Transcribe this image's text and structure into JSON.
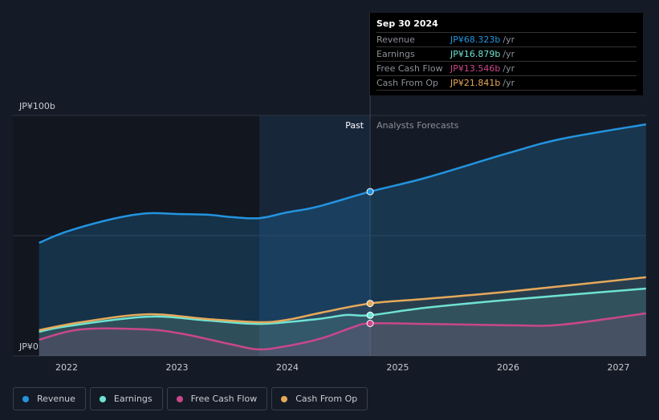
{
  "tooltip": {
    "date": "Sep 30 2024",
    "unit": "/yr",
    "rows": [
      {
        "label": "Revenue",
        "value": "JP¥68.323b",
        "color": "#2394df"
      },
      {
        "label": "Earnings",
        "value": "JP¥16.879b",
        "color": "#6fe3d3"
      },
      {
        "label": "Free Cash Flow",
        "value": "JP¥13.546b",
        "color": "#c9478a"
      },
      {
        "label": "Cash From Op",
        "value": "JP¥21.841b",
        "color": "#e6a95a"
      }
    ]
  },
  "chart_data": {
    "type": "line",
    "ylim": [
      0,
      100
    ],
    "y_ticks": [
      "JP¥0",
      "JP¥100b"
    ],
    "x_ticks": [
      "2022",
      "2023",
      "2024",
      "2025",
      "2026",
      "2027"
    ],
    "past_label": "Past",
    "forecast_label": "Analysts Forecasts",
    "divider_x": 2024.75,
    "series": [
      {
        "name": "Revenue",
        "color": "#2394df",
        "points": [
          [
            2021.75,
            47
          ],
          [
            2022,
            51.7
          ],
          [
            2022.42,
            57
          ],
          [
            2022.73,
            59.3
          ],
          [
            2023,
            59
          ],
          [
            2023.28,
            58.7
          ],
          [
            2023.5,
            57.7
          ],
          [
            2023.75,
            57.3
          ],
          [
            2024,
            59.7
          ],
          [
            2024.27,
            62
          ],
          [
            2024.75,
            68.3
          ],
          [
            2025.25,
            74
          ],
          [
            2026,
            84.3
          ],
          [
            2026.49,
            90.3
          ],
          [
            2027.25,
            96.3
          ]
        ]
      },
      {
        "name": "Earnings",
        "color": "#6fe3d3",
        "points": [
          [
            2021.75,
            10
          ],
          [
            2022,
            12.3
          ],
          [
            2022.73,
            16.3
          ],
          [
            2023.28,
            14.7
          ],
          [
            2023.75,
            13.3
          ],
          [
            2024.27,
            15.3
          ],
          [
            2024.53,
            17
          ],
          [
            2024.75,
            16.9
          ],
          [
            2025.25,
            20
          ],
          [
            2026,
            23.3
          ],
          [
            2027.25,
            28
          ]
        ]
      },
      {
        "name": "Free Cash Flow",
        "color": "#c9478a",
        "points": [
          [
            2021.75,
            6.7
          ],
          [
            2022.13,
            11
          ],
          [
            2022.73,
            11
          ],
          [
            2023.07,
            9
          ],
          [
            2023.5,
            4.7
          ],
          [
            2023.75,
            2.7
          ],
          [
            2024.02,
            4.3
          ],
          [
            2024.31,
            7.3
          ],
          [
            2024.6,
            12
          ],
          [
            2024.75,
            13.5
          ],
          [
            2025.25,
            13.3
          ],
          [
            2026.05,
            12.7
          ],
          [
            2026.49,
            13
          ],
          [
            2027.25,
            17.7
          ]
        ]
      },
      {
        "name": "Cash From Op",
        "color": "#e6a95a",
        "points": [
          [
            2021.75,
            10.7
          ],
          [
            2022.13,
            14
          ],
          [
            2022.73,
            17.3
          ],
          [
            2023.28,
            15.3
          ],
          [
            2023.75,
            14
          ],
          [
            2024,
            15
          ],
          [
            2024.31,
            18
          ],
          [
            2024.75,
            21.8
          ],
          [
            2025.25,
            23.7
          ],
          [
            2026,
            26.7
          ],
          [
            2027.25,
            32.7
          ]
        ]
      }
    ]
  }
}
